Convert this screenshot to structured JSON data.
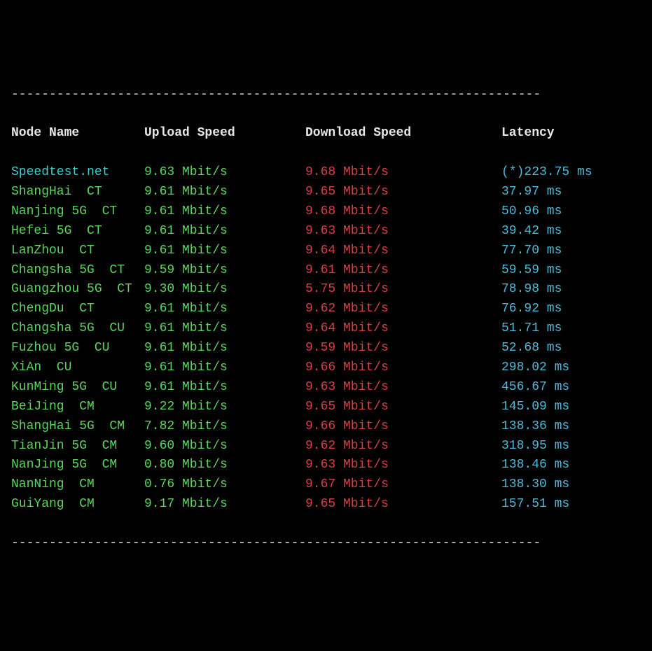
{
  "dash_line": "----------------------------------------------------------------------",
  "headers": {
    "node": "Node Name",
    "upload": "Upload Speed",
    "download": "Download Speed",
    "latency": "Latency"
  },
  "rows": [
    {
      "node": "Speedtest.net",
      "node_color": "cyan",
      "upload": "9.63 Mbit/s",
      "download": "9.68 Mbit/s",
      "latency": "(*)223.75 ms"
    },
    {
      "node": "ShangHai  CT",
      "node_color": "green",
      "upload": "9.61 Mbit/s",
      "download": "9.65 Mbit/s",
      "latency": "37.97 ms"
    },
    {
      "node": "Nanjing 5G  CT",
      "node_color": "green",
      "upload": "9.61 Mbit/s",
      "download": "9.68 Mbit/s",
      "latency": "50.96 ms"
    },
    {
      "node": "Hefei 5G  CT",
      "node_color": "green",
      "upload": "9.61 Mbit/s",
      "download": "9.63 Mbit/s",
      "latency": "39.42 ms"
    },
    {
      "node": "LanZhou  CT",
      "node_color": "green",
      "upload": "9.61 Mbit/s",
      "download": "9.64 Mbit/s",
      "latency": "77.70 ms"
    },
    {
      "node": "Changsha 5G  CT",
      "node_color": "green",
      "upload": "9.59 Mbit/s",
      "download": "9.61 Mbit/s",
      "latency": "59.59 ms"
    },
    {
      "node": "Guangzhou 5G  CT",
      "node_color": "green",
      "upload": "9.30 Mbit/s",
      "download": "5.75 Mbit/s",
      "latency": "78.98 ms"
    },
    {
      "node": "ChengDu  CT",
      "node_color": "green",
      "upload": "9.61 Mbit/s",
      "download": "9.62 Mbit/s",
      "latency": "76.92 ms"
    },
    {
      "node": "Changsha 5G  CU",
      "node_color": "green",
      "upload": "9.61 Mbit/s",
      "download": "9.64 Mbit/s",
      "latency": "51.71 ms"
    },
    {
      "node": "Fuzhou 5G  CU",
      "node_color": "green",
      "upload": "9.61 Mbit/s",
      "download": "9.59 Mbit/s",
      "latency": "52.68 ms"
    },
    {
      "node": "XiAn  CU",
      "node_color": "green",
      "upload": "9.61 Mbit/s",
      "download": "9.66 Mbit/s",
      "latency": "298.02 ms"
    },
    {
      "node": "KunMing 5G  CU",
      "node_color": "green",
      "upload": "9.61 Mbit/s",
      "download": "9.63 Mbit/s",
      "latency": "456.67 ms"
    },
    {
      "node": "BeiJing  CM",
      "node_color": "green",
      "upload": "9.22 Mbit/s",
      "download": "9.65 Mbit/s",
      "latency": "145.09 ms"
    },
    {
      "node": "ShangHai 5G  CM",
      "node_color": "green",
      "upload": "7.82 Mbit/s",
      "download": "9.66 Mbit/s",
      "latency": "138.36 ms"
    },
    {
      "node": "TianJin 5G  CM",
      "node_color": "green",
      "upload": "9.60 Mbit/s",
      "download": "9.62 Mbit/s",
      "latency": "318.95 ms"
    },
    {
      "node": "NanJing 5G  CM",
      "node_color": "green",
      "upload": "0.80 Mbit/s",
      "download": "9.63 Mbit/s",
      "latency": "138.46 ms"
    },
    {
      "node": "NanNing  CM",
      "node_color": "green",
      "upload": "0.76 Mbit/s",
      "download": "9.67 Mbit/s",
      "latency": "138.30 ms"
    },
    {
      "node": "GuiYang  CM",
      "node_color": "green",
      "upload": "9.17 Mbit/s",
      "download": "9.65 Mbit/s",
      "latency": "157.51 ms"
    }
  ]
}
